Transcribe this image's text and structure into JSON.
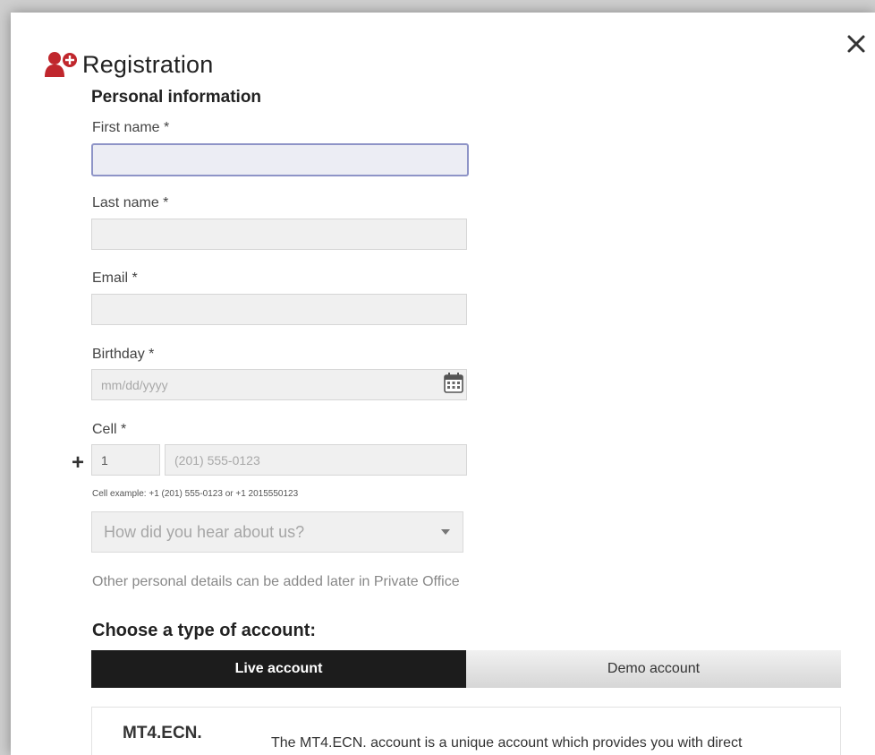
{
  "header": {
    "title": "Registration",
    "icon": "user-add-icon",
    "close_icon": "close-icon"
  },
  "personal": {
    "heading": "Personal information",
    "first_name": {
      "label": "First name *",
      "value": ""
    },
    "last_name": {
      "label": "Last name *",
      "value": ""
    },
    "email": {
      "label": "Email *",
      "value": ""
    },
    "birthday": {
      "label": "Birthday *",
      "placeholder": "mm/dd/yyyy",
      "icon": "calendar-icon"
    },
    "cell": {
      "label": "Cell *",
      "prefix": "+",
      "country_code": "1",
      "placeholder": "(201) 555-0123",
      "hint": "Cell example: +1 (201) 555-0123 or +1 2015550123"
    },
    "referral_select": {
      "placeholder": "How did you hear about us?"
    },
    "note": "Other personal details can be added later in Private Office"
  },
  "account": {
    "heading": "Choose a type of account:",
    "tabs": [
      {
        "label": "Live account",
        "active": true
      },
      {
        "label": "Demo account",
        "active": false
      }
    ],
    "card": {
      "name": "MT4.ECN.",
      "description": "The MT4.ECN. account is a unique account which provides you with direct"
    }
  },
  "colors": {
    "accent_red": "#c0272d",
    "active_tab": "#1c1c1c",
    "focus_border": "#8e94c7"
  }
}
